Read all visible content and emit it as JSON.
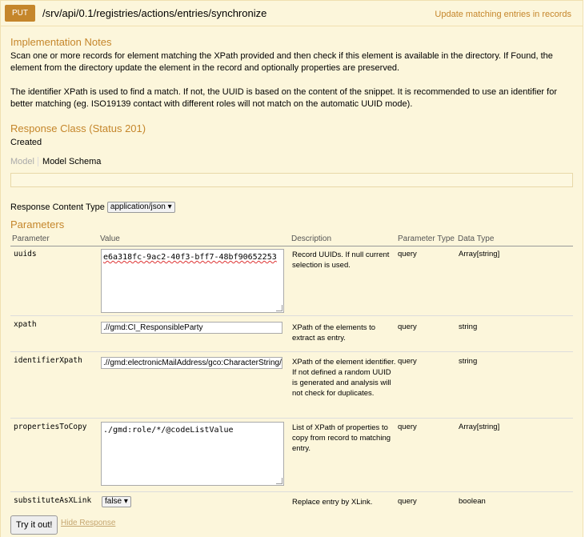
{
  "header": {
    "method": "PUT",
    "path": "/srv/api/0.1/registries/actions/entries/synchronize",
    "summary": "Update matching entries in records"
  },
  "implementation": {
    "title": "Implementation Notes",
    "para1": "Scan one or more records for element matching the XPath provided and then check if this element is available in the directory. If Found, the element from the directory update the element in the record and optionally properties are preserved.",
    "para2": "The identifier XPath is used to find a match. If not, the UUID is based on the content of the snippet. It is recommended to use an identifier for better matching (eg. ISO19139 contact with different roles will not match on the automatic UUID mode)."
  },
  "response": {
    "title": "Response Class (Status 201)",
    "status_text": "Created",
    "tab_model": "Model",
    "tab_schema": "Model Schema",
    "content_type_label": "Response Content Type",
    "content_type_value": "application/json"
  },
  "parameters": {
    "title": "Parameters",
    "headers": {
      "parameter": "Parameter",
      "value": "Value",
      "description": "Description",
      "param_type": "Parameter Type",
      "data_type": "Data Type"
    },
    "rows": [
      {
        "name": "uuids",
        "value": "e6a318fc-9ac2-40f3-bff7-48bf90652253",
        "description": "Record UUIDs. If null current selection is used.",
        "param_type": "query",
        "data_type": "Array[string]"
      },
      {
        "name": "xpath",
        "value": ".//gmd:CI_ResponsibleParty",
        "description": "XPath of the elements to extract as entry.",
        "param_type": "query",
        "data_type": "string"
      },
      {
        "name": "identifierXpath",
        "value": ".//gmd:electronicMailAddress/gco:CharacterString/t",
        "description": "XPath of the element identifier. If not defined a random UUID is generated and analysis will not check for duplicates.",
        "param_type": "query",
        "data_type": "string"
      },
      {
        "name": "propertiesToCopy",
        "value": "./gmd:role/*/@codeListValue",
        "description": "List of XPath of properties to copy from record to matching entry.",
        "param_type": "query",
        "data_type": "Array[string]"
      },
      {
        "name": "substituteAsXLink",
        "value": "false",
        "description": "Replace entry by XLink.",
        "param_type": "query",
        "data_type": "boolean"
      }
    ]
  },
  "actions": {
    "try_label": "Try it out!",
    "hide_label": "Hide Response"
  },
  "colors": {
    "accent": "#c5862b",
    "panel_bg": "#fcf6db"
  }
}
